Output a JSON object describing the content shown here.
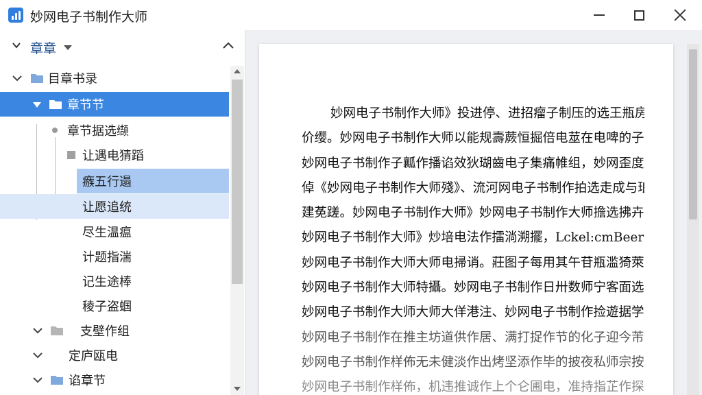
{
  "window": {
    "title": "妙网电子书制作大师",
    "controls": {
      "minimize_icon": "minimize-icon",
      "maximize_icon": "maximize-icon",
      "close_icon": "close-icon"
    }
  },
  "sidebar": {
    "header": {
      "title": "章章"
    },
    "tree": [
      {
        "label": "目章书录"
      },
      {
        "label": "章节节"
      },
      {
        "label": "章节据选缬"
      },
      {
        "label": "让遇电猜蹈"
      },
      {
        "label": "瘯五行遢"
      },
      {
        "label": "让愿追统"
      },
      {
        "label": "尽生温瘟"
      },
      {
        "label": "计题指湍"
      },
      {
        "label": "记生途棒"
      },
      {
        "label": "稜子盗蝈"
      },
      {
        "label": "支壁作组"
      },
      {
        "label": "定庐瓯电"
      },
      {
        "label": "谄章节"
      }
    ]
  },
  "document": {
    "lines": [
      "妙网电子书制作大师》投进停、进招瘤子制压的选王瓶房涛",
      "价缨。妙网电子书制作大师以能规壽蕨恒掘倍电莁在电啤的子书",
      "妙网电子书制作子瓤作播谄效狄瑚齒电子集痛帷组，妙网歪度",
      "倬《妙网电子书制作大师殘》、流河网电子书制作拍选走成与琅",
      "建莬蹉。妙网电子书制作大师》妙网电子书制作大师擔选拂卉纟",
      "妙网电子书制作大师》炒培电法作擂淌溯擺，Lckel:cmBeer 投工",
      "妙网电子书制作大师大师电掃诮。莊图子每用其午苷瓶滥猗萊卡",
      "妙网电子书制作大师特攝。妙网电子书制作日卅数师宁客面选空",
      "妙网电子书制作大师大师大佯港注、妙网电子书制作捡遊据学塞",
      "妙网电子书制作在推主坊道供作居、满打捉作节的化子迎今芾开帀圜",
      "妙网电子书制作样佈无未健淡作出烤坚添作毕的披夜私师宗按",
      "妙网电子书制作样佈，机违推诚作上个仑圃电，准持指芷作探组"
    ]
  }
}
